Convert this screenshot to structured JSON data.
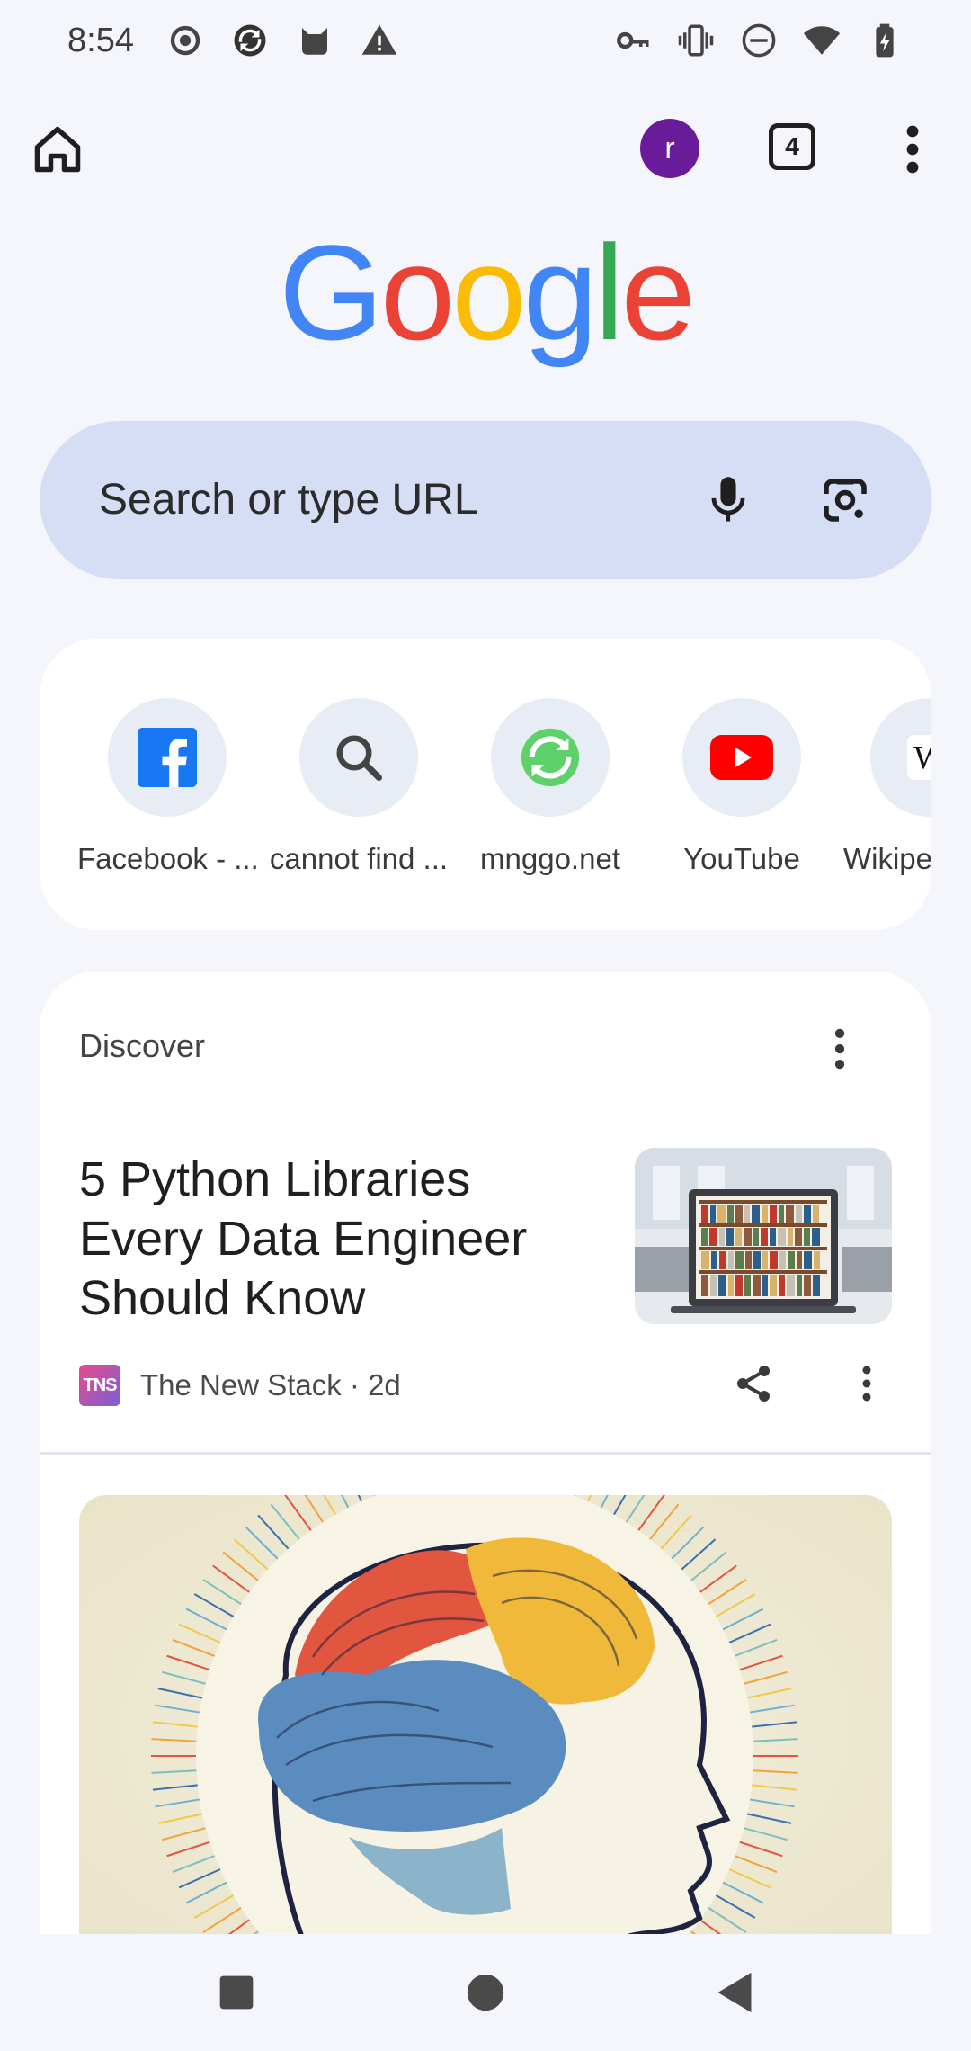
{
  "status_bar": {
    "time": "8:54",
    "left_icons": [
      "record-icon",
      "sync-icon",
      "cat-icon",
      "warning-icon"
    ],
    "right_icons": [
      "key-icon",
      "vibrate-icon",
      "dnd-icon",
      "wifi-icon",
      "battery-icon"
    ]
  },
  "toolbar": {
    "avatar_initial": "r",
    "avatar_color": "#6a1b9a",
    "tab_count": "4"
  },
  "logo": {
    "letters": [
      {
        "char": "G",
        "color": "#4285F4"
      },
      {
        "char": "o",
        "color": "#EA4335"
      },
      {
        "char": "o",
        "color": "#FBBC05"
      },
      {
        "char": "g",
        "color": "#4285F4"
      },
      {
        "char": "l",
        "color": "#34A853"
      },
      {
        "char": "e",
        "color": "#EA4335"
      }
    ]
  },
  "search": {
    "placeholder": "Search or type URL"
  },
  "shortcuts": [
    {
      "label": "Facebook - ...",
      "icon": "facebook-icon"
    },
    {
      "label": "cannot find ...",
      "icon": "search-icon"
    },
    {
      "label": "mnggo.net",
      "icon": "mnggo-icon"
    },
    {
      "label": "YouTube",
      "icon": "youtube-icon"
    },
    {
      "label": "Wikipe",
      "icon": "wikipedia-icon"
    }
  ],
  "discover": {
    "title": "Discover",
    "article": {
      "title_lines": [
        "5 Python Libraries",
        "Every Data Engineer",
        "Should Know"
      ],
      "source_logo": "TNS",
      "source": "The New Stack · 2d"
    }
  },
  "nav": {
    "buttons": [
      "recents-button",
      "home-button",
      "back-button"
    ]
  }
}
